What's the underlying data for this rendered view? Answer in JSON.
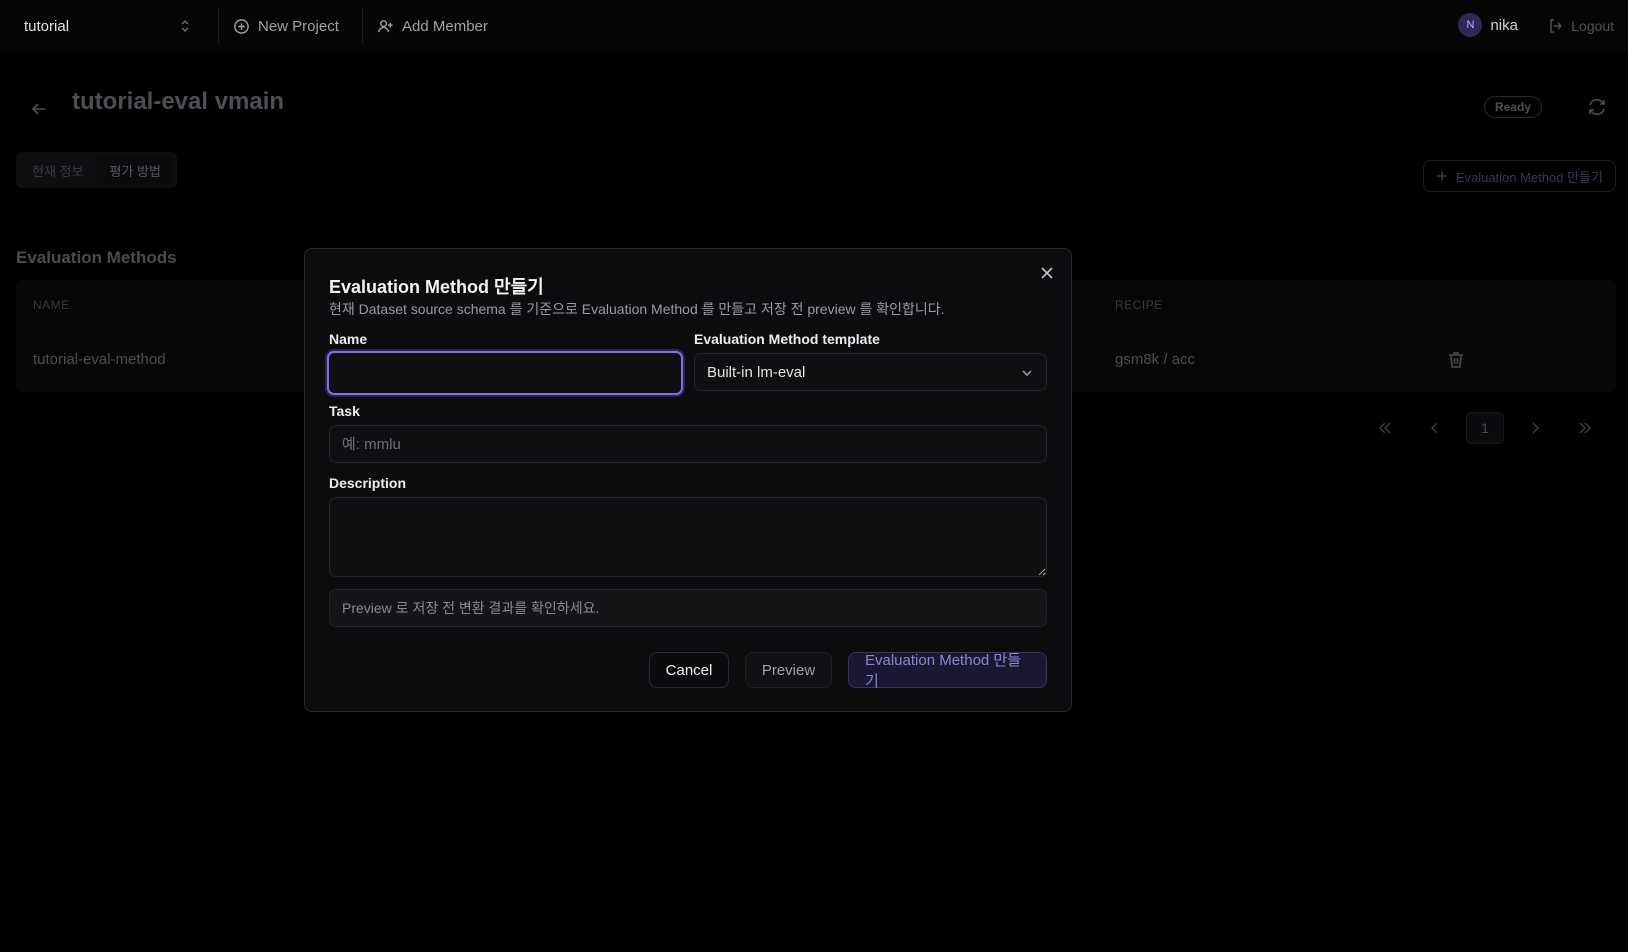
{
  "topbar": {
    "project": "tutorial",
    "new_project": "New Project",
    "add_member": "Add Member",
    "user_initial": "N",
    "user_name": "nika",
    "logout": "Logout"
  },
  "page": {
    "title": "tutorial-eval vmain",
    "status": "Ready",
    "tabs": [
      "현재 정보",
      "평가 방법"
    ],
    "create_button": "Evaluation Method 만들기",
    "section_title": "Evaluation Methods",
    "table": {
      "headers": {
        "name": "NAME",
        "recipe": "RECIPE"
      },
      "rows": [
        {
          "name": "tutorial-eval-method",
          "recipe": "gsm8k / acc"
        }
      ]
    },
    "pagination": {
      "current_page": "1"
    }
  },
  "dialog": {
    "title": "Evaluation Method 만들기",
    "description": "현재 Dataset source schema 를 기준으로 Evaluation Method 를 만들고 저장 전 preview 를 확인합니다.",
    "name_label": "Name",
    "name_value": "",
    "template_label": "Evaluation Method template",
    "template_value": "Built-in lm-eval",
    "task_label": "Task",
    "task_placeholder": "예: mmlu",
    "description_label": "Description",
    "description_value": "",
    "preview_hint": "Preview 로 저장 전 변환 결과를 확인하세요.",
    "cancel": "Cancel",
    "preview": "Preview",
    "submit": "Evaluation Method 만들기"
  },
  "colors": {
    "accent": "#7c6ff0",
    "background": "#000000",
    "dialog": "#0c0c0e"
  }
}
